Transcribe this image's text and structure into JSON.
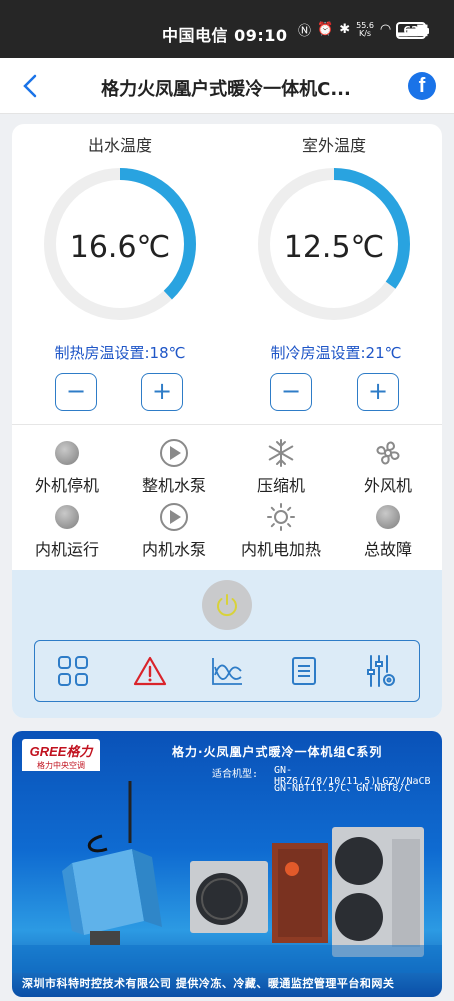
{
  "status_bar": {
    "carrier_time": "中国电信 09:10",
    "speed_top": "55.6",
    "speed_unit": "K/s",
    "battery": "63"
  },
  "nav": {
    "title": "格力火凤凰户式暖冷一体机C..."
  },
  "gauges": [
    {
      "label": "出水温度",
      "value": "16.6℃",
      "fill_fraction": 0.38
    },
    {
      "label": "室外温度",
      "value": "12.5℃",
      "fill_fraction": 0.35
    }
  ],
  "settings": {
    "heating": "制热房温设置:18℃",
    "cooling": "制冷房温设置:21℃",
    "minus": "−",
    "plus": "+"
  },
  "status_items": [
    {
      "label": "外机停机",
      "icon": "lamp-icon"
    },
    {
      "label": "整机水泵",
      "icon": "play-icon"
    },
    {
      "label": "压缩机",
      "icon": "snowflake-icon"
    },
    {
      "label": "外风机",
      "icon": "fan-icon"
    },
    {
      "label": "内机运行",
      "icon": "lamp-icon"
    },
    {
      "label": "内机水泵",
      "icon": "play-icon"
    },
    {
      "label": "内机电加热",
      "icon": "sun-icon"
    },
    {
      "label": "总故障",
      "icon": "lamp-icon"
    }
  ],
  "toolbar": [
    "grid-icon",
    "warning-icon",
    "chart-icon",
    "list-icon",
    "settings-sliders-icon"
  ],
  "banner": {
    "brand": "GREE格力",
    "brand_sub": "格力中央空调",
    "title": "格力·火凤凰户式暖冷一体机组C系列",
    "models_label": "适合机型:",
    "models_1": "GN-HRZ6(7/8/10/11.5)LGZV/NaCB",
    "models_2": "GN-NBT11.5/C、GN-NBT8/C",
    "footer": "深圳市科特时控技术有限公司    提供冷冻、冷藏、暖通监控管理平台和网关"
  },
  "colors": {
    "accent": "#2e7cc7",
    "gauge_fill": "#29a3e0",
    "gauge_track": "#eeeeee",
    "setting_text": "#1f56c7",
    "control_bg": "#dcebf7"
  }
}
